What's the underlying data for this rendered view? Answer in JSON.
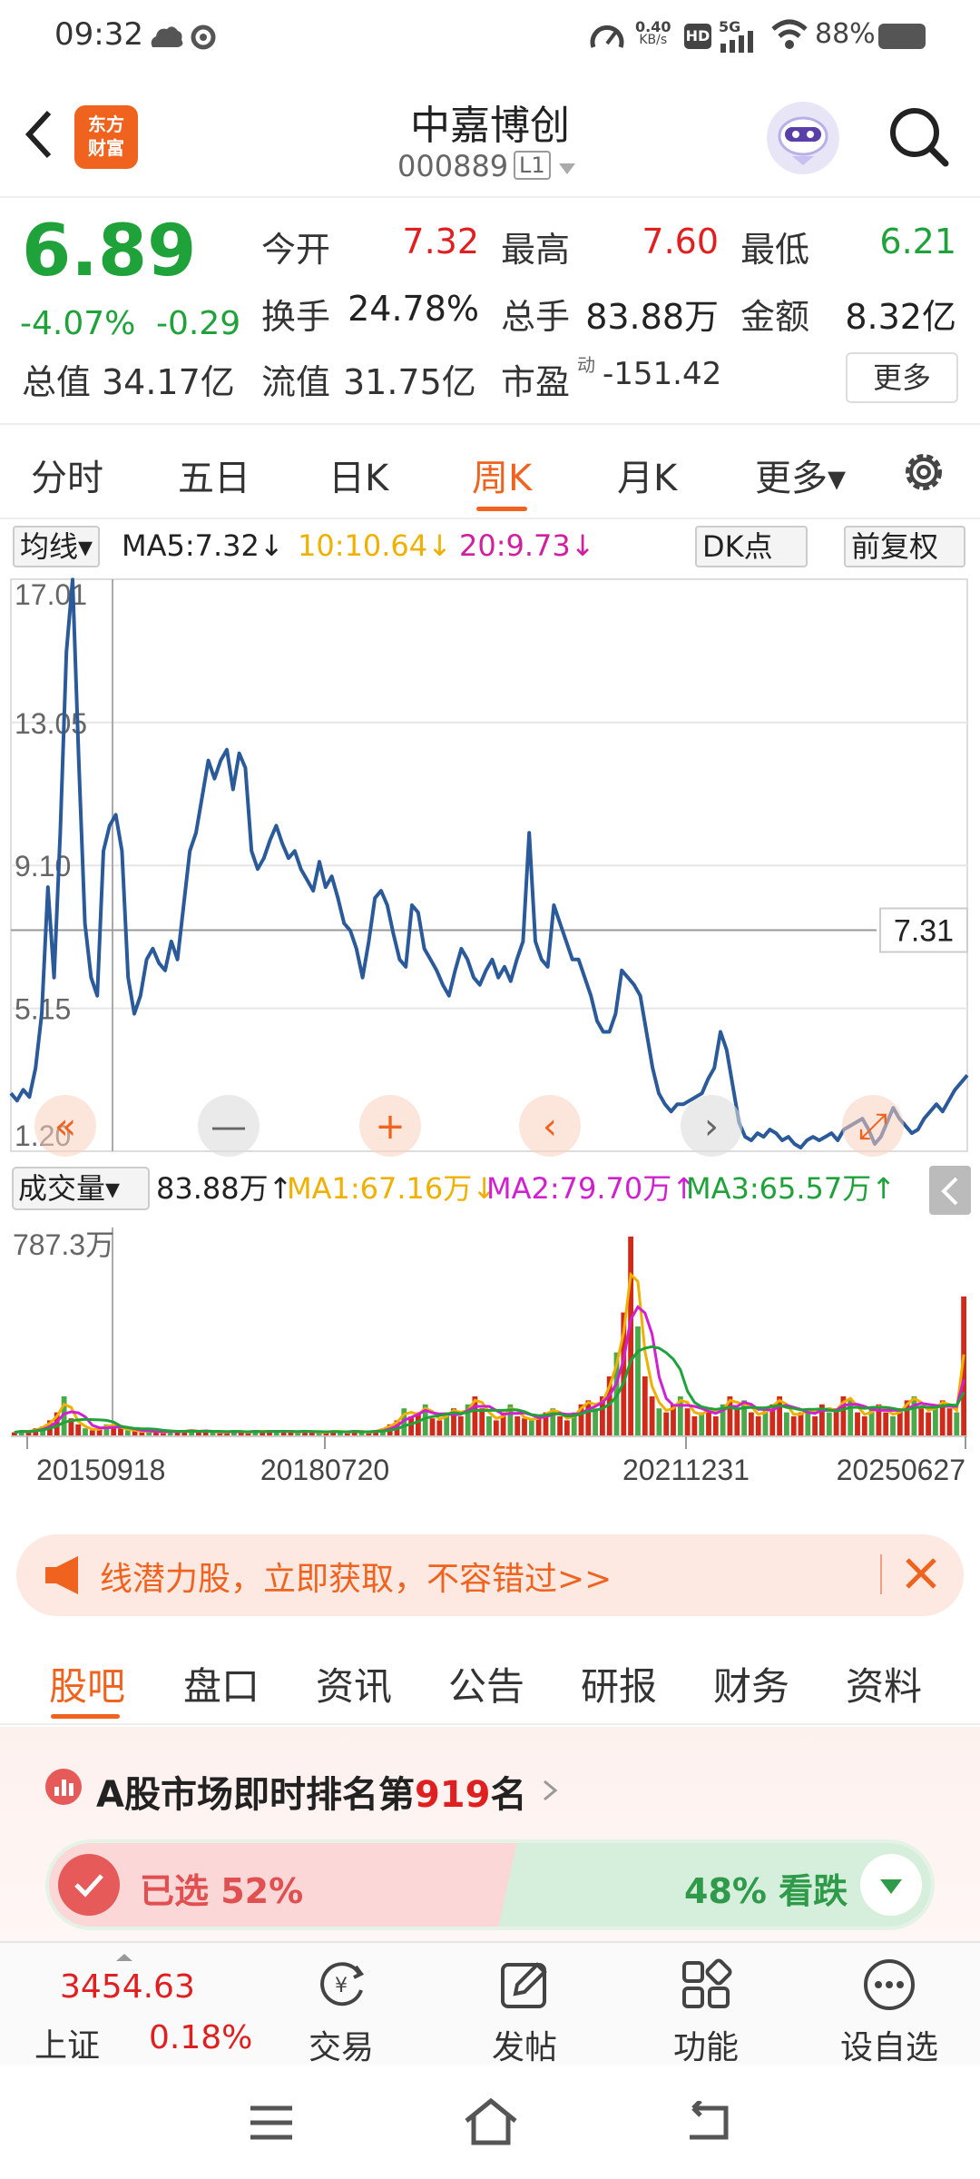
{
  "status_bar": {
    "time": "09:32",
    "net_speed": "0.40",
    "net_unit": "KB/s",
    "signal": "5G",
    "battery": "88%"
  },
  "header": {
    "logo_text": "东方\n财富",
    "stock_name": "中嘉博创",
    "stock_code": "000889",
    "level_badge": "L1"
  },
  "quote": {
    "price": "6.89",
    "change_pct": "-4.07%",
    "change_abs": "-0.29",
    "rows": [
      [
        {
          "label": "今开",
          "value": "7.32",
          "color": "red"
        },
        {
          "label": "最高",
          "value": "7.60",
          "color": "red"
        },
        {
          "label": "最低",
          "value": "6.21",
          "color": "green"
        }
      ],
      [
        {
          "label": "换手",
          "value": "24.78%",
          "color": "dark"
        },
        {
          "label": "总手",
          "value": "83.88万",
          "color": "dark"
        },
        {
          "label": "金额",
          "value": "8.32亿",
          "color": "dark"
        }
      ]
    ],
    "total_value_label": "总值",
    "total_value": "34.17亿",
    "float_value_label": "流值",
    "float_value": "31.75亿",
    "pe_label": "市盈",
    "pe_sup": "动",
    "pe_value": "-151.42",
    "more_label": "更多"
  },
  "period_tabs": [
    "分时",
    "五日",
    "日K",
    "周K",
    "月K",
    "更多▾"
  ],
  "active_period": "周K",
  "indicator": {
    "ma_select": "均线▾",
    "ma5": "MA5:7.32↓",
    "ma10": "10:10.64↓",
    "ma20": "20:9.73↓",
    "dk_label": "DK点",
    "adjust_label": "前复权",
    "colors": {
      "ma5": "#222222",
      "ma10": "#f0b000",
      "ma20": "#d020a0"
    }
  },
  "chart_data": {
    "type": "line",
    "ylim": [
      1.2,
      17.01
    ],
    "y_ticks": [
      "17.01",
      "13.05",
      "9.10",
      "5.15",
      "1.20"
    ],
    "current_price_line": "7.31",
    "line_color": "#2a5a9a",
    "x_labels": [
      "20150918",
      "20180720",
      "20211231",
      "20250627"
    ],
    "price_series": [
      2.8,
      2.6,
      2.9,
      2.7,
      3.5,
      5.0,
      8.5,
      6.0,
      10.0,
      15.0,
      17.0,
      12.0,
      7.5,
      6.0,
      5.5,
      9.5,
      10.2,
      10.5,
      9.5,
      6.0,
      5.0,
      5.5,
      6.5,
      6.8,
      6.4,
      6.2,
      7.0,
      6.5,
      8.0,
      9.5,
      10.0,
      11.0,
      12.0,
      11.5,
      12.0,
      12.3,
      11.2,
      12.2,
      11.8,
      9.5,
      9.0,
      9.3,
      9.8,
      10.2,
      9.7,
      9.3,
      9.5,
      9.0,
      8.7,
      8.4,
      9.2,
      8.5,
      8.8,
      8.2,
      7.5,
      7.3,
      6.8,
      6.0,
      7.0,
      8.2,
      8.4,
      8.0,
      7.2,
      6.5,
      6.3,
      8.0,
      7.8,
      6.8,
      6.5,
      6.2,
      5.8,
      5.5,
      6.2,
      6.8,
      6.5,
      6.0,
      5.8,
      6.2,
      6.5,
      6.0,
      6.3,
      5.9,
      6.5,
      7.0,
      10.0,
      7.0,
      6.5,
      6.3,
      8.0,
      7.5,
      7.0,
      6.5,
      6.5,
      6.0,
      5.5,
      4.8,
      4.5,
      4.5,
      5.0,
      6.2,
      6.0,
      5.8,
      5.5,
      4.5,
      3.5,
      2.8,
      2.5,
      2.3,
      2.5,
      2.5,
      2.6,
      2.7,
      2.8,
      3.2,
      3.5,
      4.5,
      4.0,
      3.0,
      2.0,
      1.6,
      1.5,
      1.7,
      1.6,
      1.8,
      1.7,
      1.5,
      1.6,
      1.4,
      1.3,
      1.5,
      1.6,
      1.5,
      1.6,
      1.7,
      1.5,
      1.8,
      1.9,
      2.0,
      2.1,
      1.8,
      1.4,
      1.6,
      2.0,
      2.4,
      2.1,
      1.9,
      1.7,
      1.8,
      2.1,
      2.3,
      2.5,
      2.3,
      2.6,
      2.9,
      3.1,
      3.3
    ]
  },
  "chart_buttons": [
    "«",
    "—",
    "+",
    "‹",
    "›",
    "⤢"
  ],
  "volume": {
    "select": "成交量▾",
    "current": "83.88万↑",
    "ma1": "MA1:67.16万↓",
    "ma2": "MA2:79.70万↑",
    "ma3": "MA3:65.57万↑",
    "max_label": "787.3万",
    "x_labels": [
      "20150918",
      "20180720",
      "20211231",
      "20250627"
    ],
    "colors": {
      "ma1": "#f0b000",
      "ma2": "#d020d0",
      "ma3": "#1fa23a"
    },
    "bars": [
      2,
      3,
      2,
      4,
      5,
      8,
      12,
      20,
      9,
      6,
      4,
      3,
      4,
      6,
      5,
      4,
      3,
      3,
      2,
      3,
      2,
      2,
      3,
      2,
      3,
      3,
      2,
      3,
      2,
      2,
      2,
      3,
      2,
      2,
      3,
      2,
      3,
      2,
      3,
      2,
      2,
      3,
      2,
      2,
      2,
      3,
      2,
      2,
      3,
      2,
      2,
      3,
      4,
      6,
      8,
      14,
      10,
      12,
      16,
      9,
      8,
      12,
      14,
      10,
      16,
      20,
      14,
      10,
      8,
      12,
      16,
      10,
      9,
      8,
      10,
      12,
      14,
      10,
      8,
      12,
      16,
      18,
      14,
      20,
      30,
      42,
      62,
      100,
      55,
      30,
      20,
      14,
      12,
      16,
      20,
      14,
      10,
      12,
      14,
      10,
      16,
      20,
      14,
      18,
      12,
      10,
      14,
      16,
      20,
      12,
      10,
      12,
      14,
      10,
      16,
      12,
      14,
      20,
      18,
      12,
      10,
      14,
      16,
      12,
      10,
      14,
      18,
      20,
      14,
      12,
      16,
      18,
      14,
      12,
      70
    ]
  },
  "banner": {
    "text": "线潜力股，立即获取，不容错过>>"
  },
  "section_tabs": [
    "股吧",
    "盘口",
    "资讯",
    "公告",
    "研报",
    "财务",
    "资料"
  ],
  "active_section": "股吧",
  "rank": {
    "prefix": "A股市场即时排名第",
    "number": "919",
    "suffix": "名",
    "bull_label": "已选 52%",
    "bear_label": "48% 看跌",
    "bull_pct": 0.52
  },
  "bottom_nav": {
    "index_value": "3454.63",
    "index_name": "上证",
    "index_pct": "0.18%",
    "items": [
      "交易",
      "发帖",
      "功能",
      "设自选"
    ]
  }
}
